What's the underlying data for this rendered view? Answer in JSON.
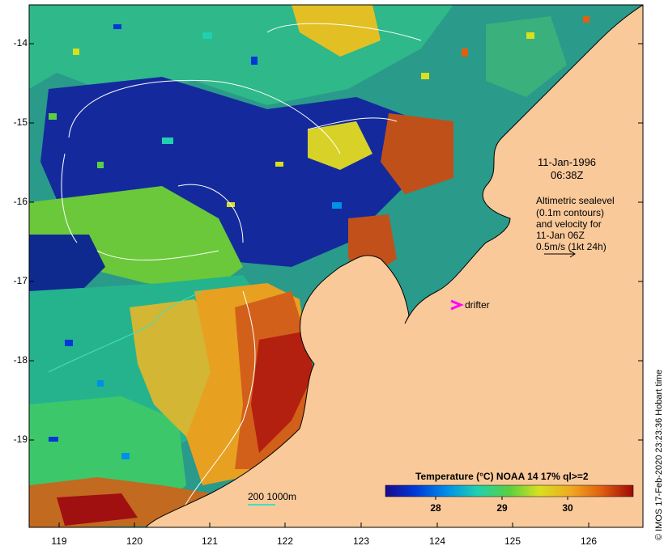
{
  "map": {
    "lat_ticks": [
      "-14",
      "-15",
      "-16",
      "-17",
      "-18",
      "-19"
    ],
    "lon_ticks": [
      "119",
      "120",
      "121",
      "122",
      "123",
      "124",
      "125",
      "126"
    ],
    "annotation": {
      "date": "11-Jan-1996",
      "time": "06:38Z",
      "lines": [
        "Altimetric sealevel",
        "(0.1m contours)",
        "and velocity for",
        "11-Jan 06Z",
        "0.5m/s (1kt 24h)"
      ]
    },
    "drifter_label": "drifter",
    "contour_label": "200  1000m",
    "legend": {
      "title": "Temperature (°C) NOAA 14 17% ql>=2",
      "ticks": [
        "28",
        "29",
        "30"
      ]
    },
    "credit": "© IMOS 17-Feb-2020 23:23:36 Hobart time",
    "colors": {
      "land": "#f9c99a",
      "coast": "#000000",
      "contour": "#ffffff",
      "bathymetry": "#40e0c0",
      "drifter": "#ff00ff",
      "scale": [
        "#1a0a8c",
        "#0038d8",
        "#0090e8",
        "#20d0b0",
        "#5ad040",
        "#d8e020",
        "#f0a820",
        "#e06010",
        "#a00808"
      ]
    }
  }
}
